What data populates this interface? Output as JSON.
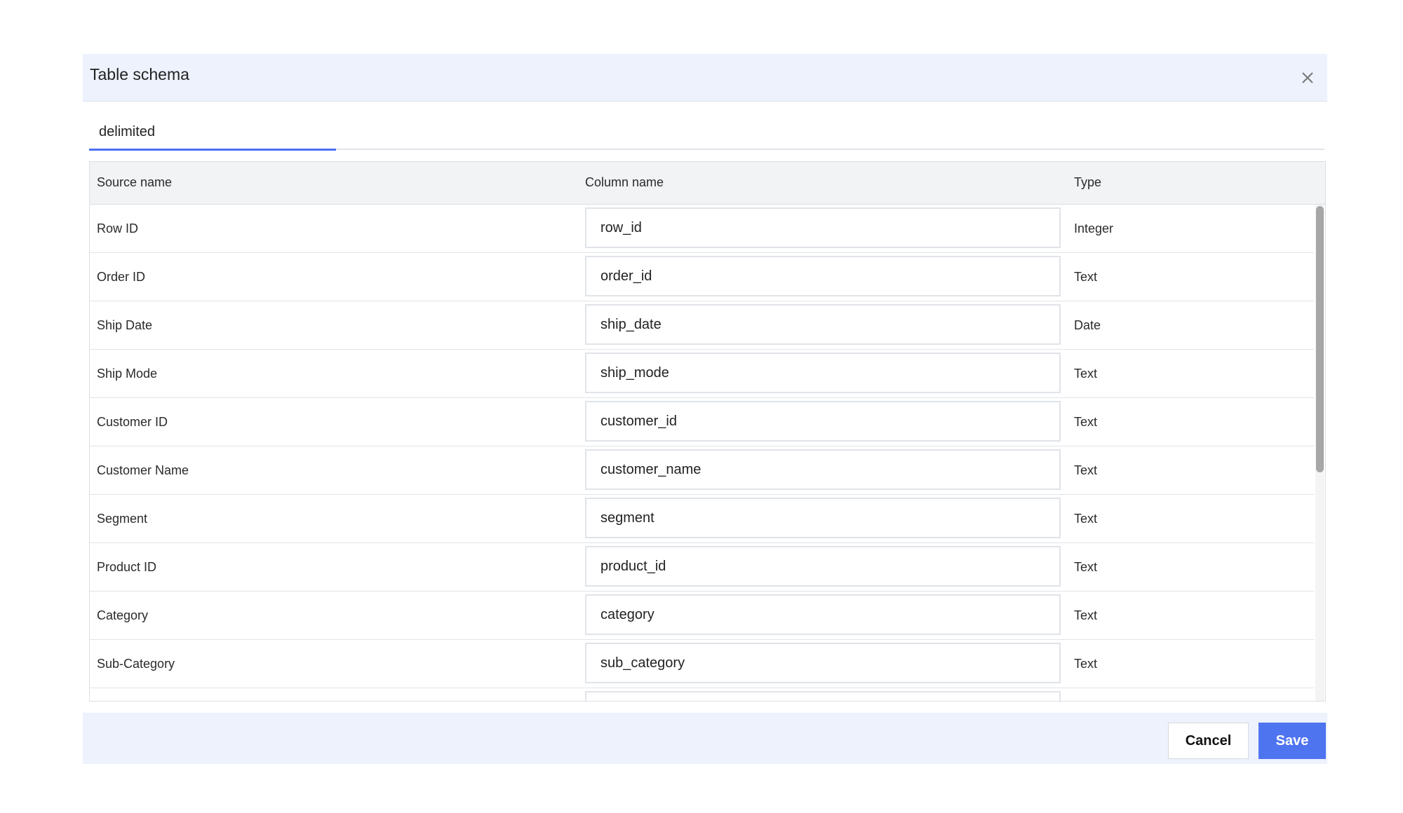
{
  "dialog": {
    "title": "Table schema",
    "close_icon": "close-icon"
  },
  "tabs": [
    {
      "label": "delimited",
      "active": true
    }
  ],
  "table": {
    "headers": {
      "source": "Source name",
      "column": "Column name",
      "type": "Type"
    },
    "rows": [
      {
        "source": "Row ID",
        "column": "row_id",
        "type": "Integer"
      },
      {
        "source": "Order ID",
        "column": "order_id",
        "type": "Text"
      },
      {
        "source": "Ship Date",
        "column": "ship_date",
        "type": "Date"
      },
      {
        "source": "Ship Mode",
        "column": "ship_mode",
        "type": "Text"
      },
      {
        "source": "Customer ID",
        "column": "customer_id",
        "type": "Text"
      },
      {
        "source": "Customer Name",
        "column": "customer_name",
        "type": "Text"
      },
      {
        "source": "Segment",
        "column": "segment",
        "type": "Text"
      },
      {
        "source": "Product ID",
        "column": "product_id",
        "type": "Text"
      },
      {
        "source": "Category",
        "column": "category",
        "type": "Text"
      },
      {
        "source": "Sub-Category",
        "column": "sub_category",
        "type": "Text"
      },
      {
        "source": "",
        "column": "",
        "type": ""
      }
    ]
  },
  "footer": {
    "cancel_label": "Cancel",
    "save_label": "Save"
  },
  "colors": {
    "accent": "#4f74f0",
    "header_bg": "#edf2fd"
  }
}
